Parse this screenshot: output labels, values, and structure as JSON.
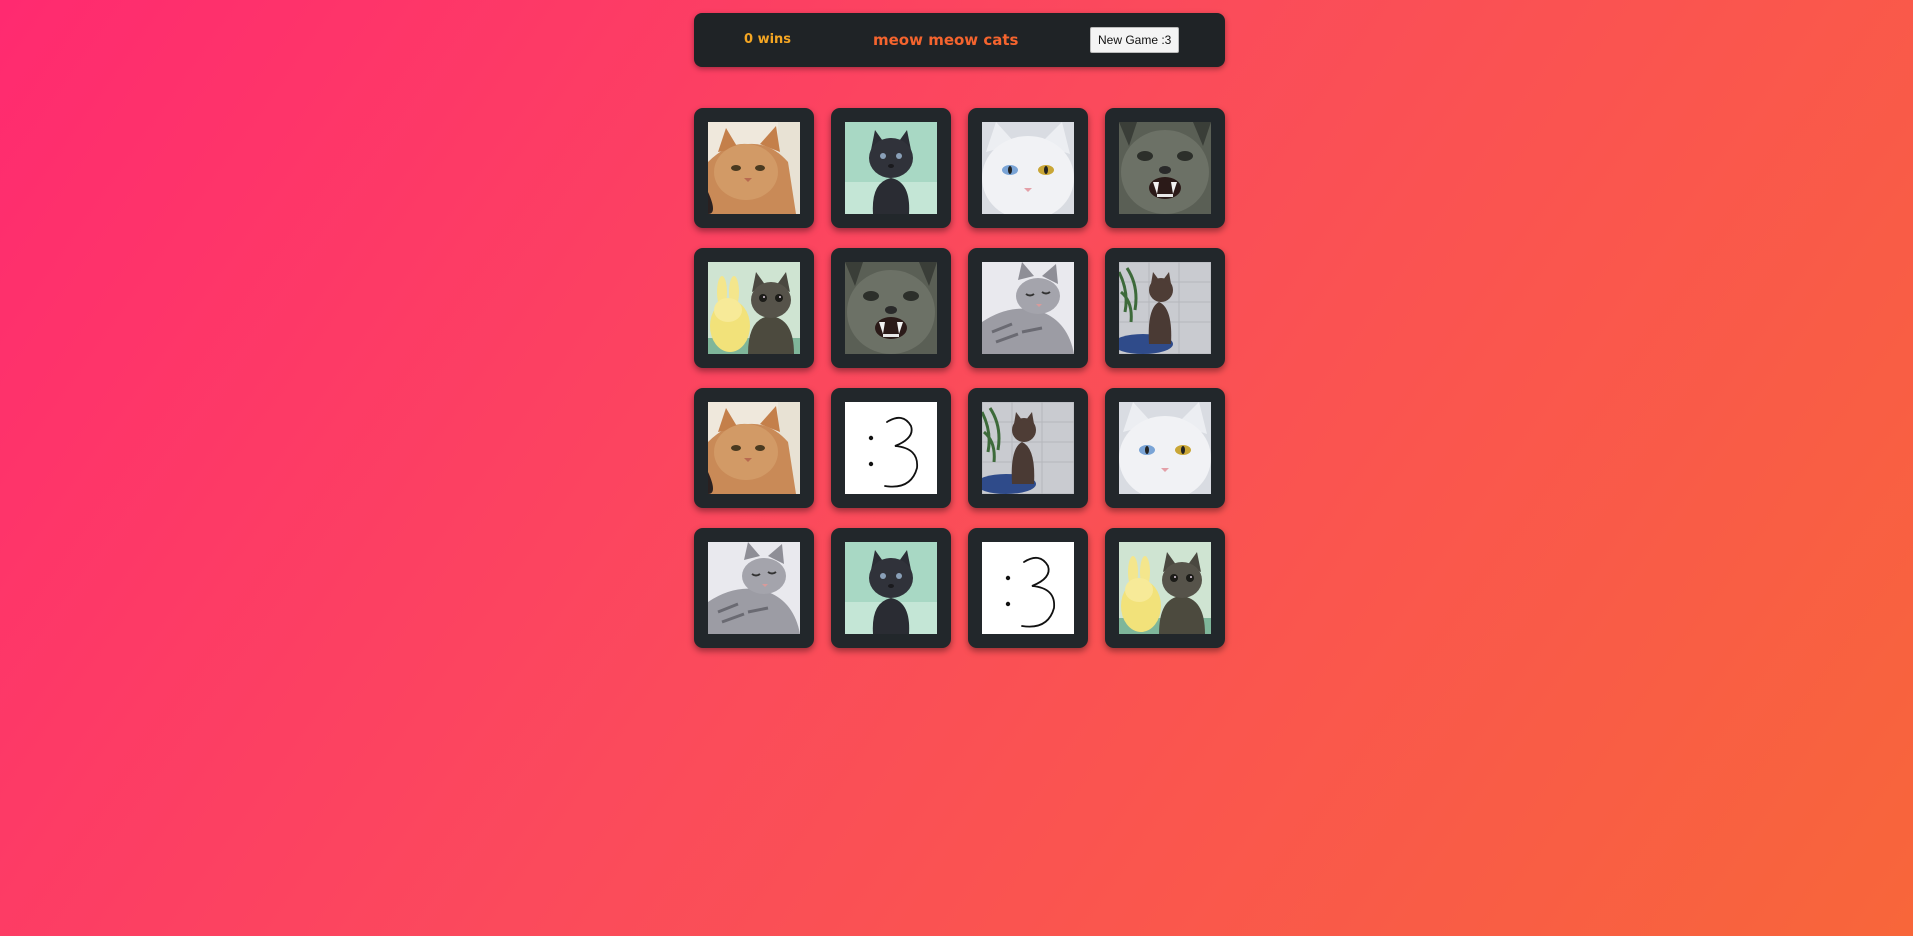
{
  "header": {
    "wins_text": "0 wins",
    "title": "meow meow cats",
    "new_game_label": "New Game :3"
  },
  "colors": {
    "panel": "#1f2326",
    "wins": "#f5a623",
    "title": "#f5642e"
  },
  "board": {
    "rows": 4,
    "cols": 4,
    "cards": [
      "ginger-cat",
      "black-kitten",
      "white-odd-eyed-cat",
      "yawning-gray-cat",
      "tabby-kitten-with-plush",
      "yawning-gray-cat",
      "sleepy-gray-tabby",
      "cat-on-patio",
      "ginger-cat",
      "colon-three-face",
      "cat-on-patio",
      "white-odd-eyed-cat",
      "sleepy-gray-tabby",
      "black-kitten",
      "colon-three-face",
      "tabby-kitten-with-plush"
    ]
  }
}
